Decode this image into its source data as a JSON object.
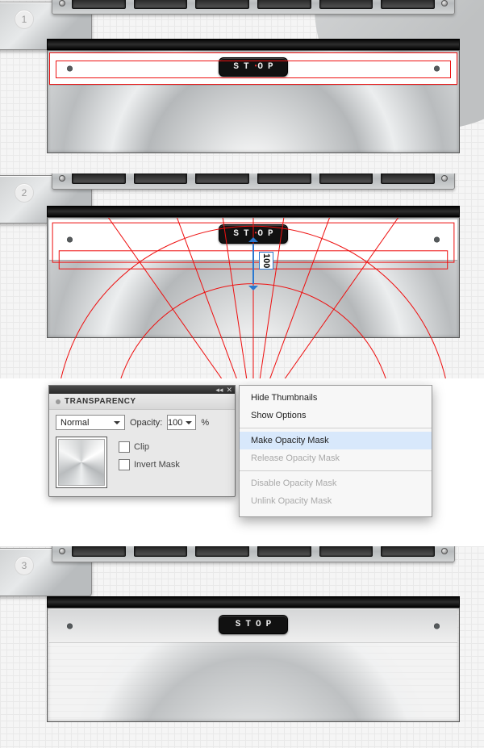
{
  "steps": {
    "one": "1",
    "two": "2",
    "three": "3"
  },
  "stop_label": "STOP",
  "measure_value": "100",
  "transparency": {
    "title": "TRANSPARENCY",
    "blend_mode": "Normal",
    "opacity_label": "Opacity:",
    "opacity_value": "100",
    "opacity_suffix": "%",
    "clip_label": "Clip",
    "invert_label": "Invert Mask"
  },
  "menu": {
    "hide_thumbnails": "Hide Thumbnails",
    "show_options": "Show Options",
    "make_mask": "Make Opacity Mask",
    "release_mask": "Release Opacity Mask",
    "disable_mask": "Disable Opacity Mask",
    "unlink_mask": "Unlink Opacity Mask"
  },
  "tabbar": {
    "collapse": "◂◂",
    "close": "✕"
  }
}
